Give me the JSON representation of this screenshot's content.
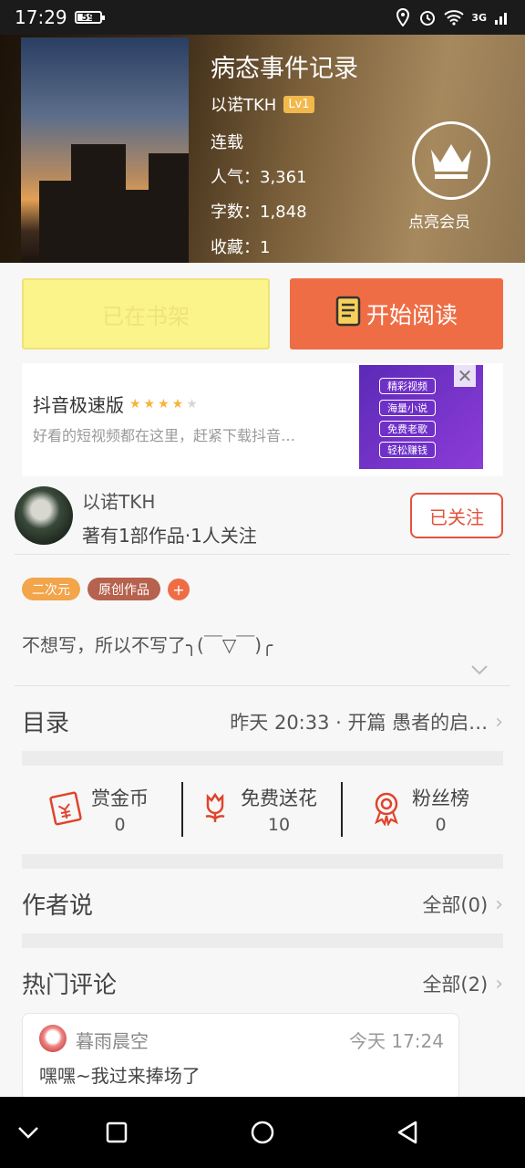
{
  "status_bar": {
    "time": "17:29",
    "battery": "59",
    "network": "3G",
    "icons": [
      "location-icon",
      "alarm-icon",
      "wifi-icon",
      "signal-icon"
    ]
  },
  "book": {
    "title": "病态事件记录",
    "author": "以诺TKH",
    "author_level": "Lv1",
    "status": "连载",
    "popularity": "人气：3,361",
    "word_count": "字数：1,848",
    "favorites": "收藏：1",
    "vip_label": "点亮会员"
  },
  "actions": {
    "shelf_label": "已在书架",
    "read_label": "开始阅读"
  },
  "ad": {
    "title": "抖音极速版",
    "rating": 4,
    "description": "好看的短视频都在这里，赶紧下载抖音…",
    "image_items": [
      "精彩视频",
      "海量小说",
      "免费老歌",
      "轻松赚钱"
    ]
  },
  "author_card": {
    "name": "以诺TKH",
    "stats": "著有1部作品·1人关注",
    "follow_label": "已关注"
  },
  "tags": [
    "二次元",
    "原创作品"
  ],
  "tag_add": "+",
  "description": "不想写，所以不写了╮(￣▽￣)╭",
  "toc": {
    "title": "目录",
    "latest": "昨天 20:33 · 开篇  愚者的启…"
  },
  "stats": [
    {
      "label": "赏金币",
      "value": "0"
    },
    {
      "label": "免费送花",
      "value": "10"
    },
    {
      "label": "粉丝榜",
      "value": "0"
    }
  ],
  "author_says": {
    "title": "作者说",
    "all": "全部(0)"
  },
  "hot_comments": {
    "title": "热门评论",
    "all": "全部(2)"
  },
  "comment": {
    "user": "暮雨晨空",
    "time": "今天 17:24",
    "text": "嘿嘿~我过来捧场了"
  },
  "colors": {
    "accent": "#ef6d45",
    "shelf_bg": "#fbf48a",
    "follow": "#e2533d",
    "tag_orange": "#f2a54a",
    "tag_brown": "#b6624e",
    "level_badge": "#f2b84b"
  }
}
